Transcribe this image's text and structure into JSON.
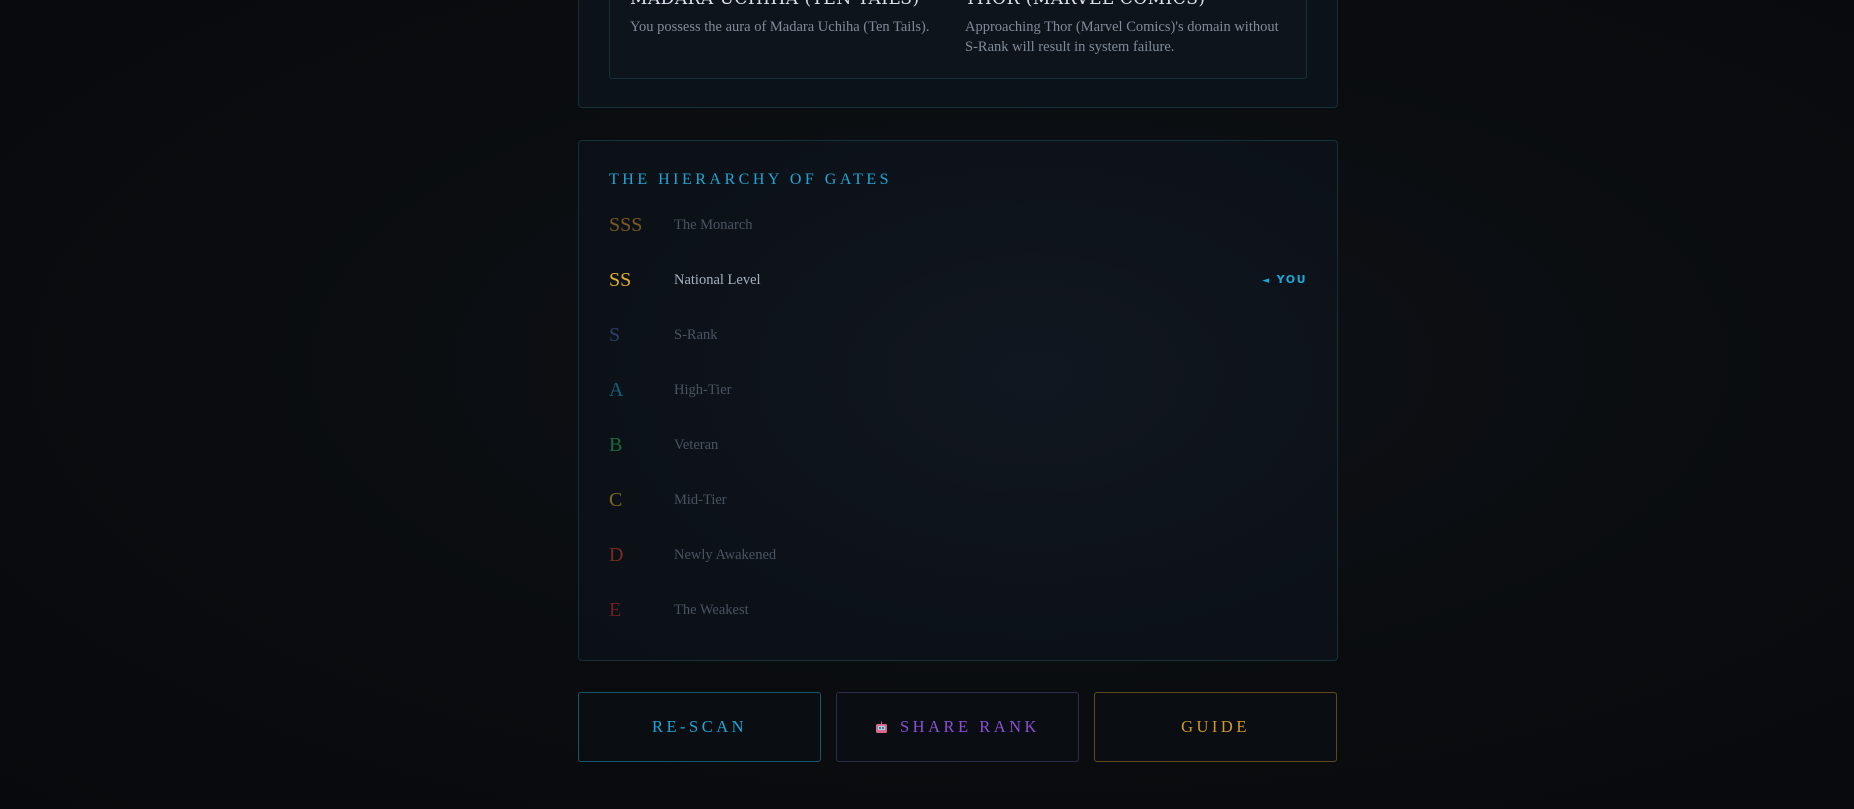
{
  "top_panel": {
    "left": {
      "name": "Madara Uchiha (Ten Tails)",
      "desc": "You possess the aura of Madara Uchiha (Ten Tails)."
    },
    "right": {
      "name": "Thor (Marvel Comics)",
      "desc": "Approaching Thor (Marvel Comics)'s domain without S-Rank will result in system failure."
    }
  },
  "hierarchy": {
    "title": "The Hierarchy of Gates",
    "you_label": "YOU",
    "ranks": [
      {
        "letter": "SSS",
        "label": "The Monarch",
        "color": "#7a5a22"
      },
      {
        "letter": "SS",
        "label": "National Level",
        "color": "#e2ae2c",
        "active": true
      },
      {
        "letter": "S",
        "label": "S-Rank",
        "color": "#2b3f6e"
      },
      {
        "letter": "A",
        "label": "High-Tier",
        "color": "#16607a"
      },
      {
        "letter": "B",
        "label": "Veteran",
        "color": "#1a6a3c"
      },
      {
        "letter": "C",
        "label": "Mid-Tier",
        "color": "#7a6a1a"
      },
      {
        "letter": "D",
        "label": "Newly Awakened",
        "color": "#7a2a22"
      },
      {
        "letter": "E",
        "label": "The Weakest",
        "color": "#6e1f24"
      }
    ]
  },
  "buttons": {
    "rescan": "Re-Scan",
    "share": "Share Rank",
    "share_icon": "share-robot-icon",
    "guide": "Guide"
  }
}
